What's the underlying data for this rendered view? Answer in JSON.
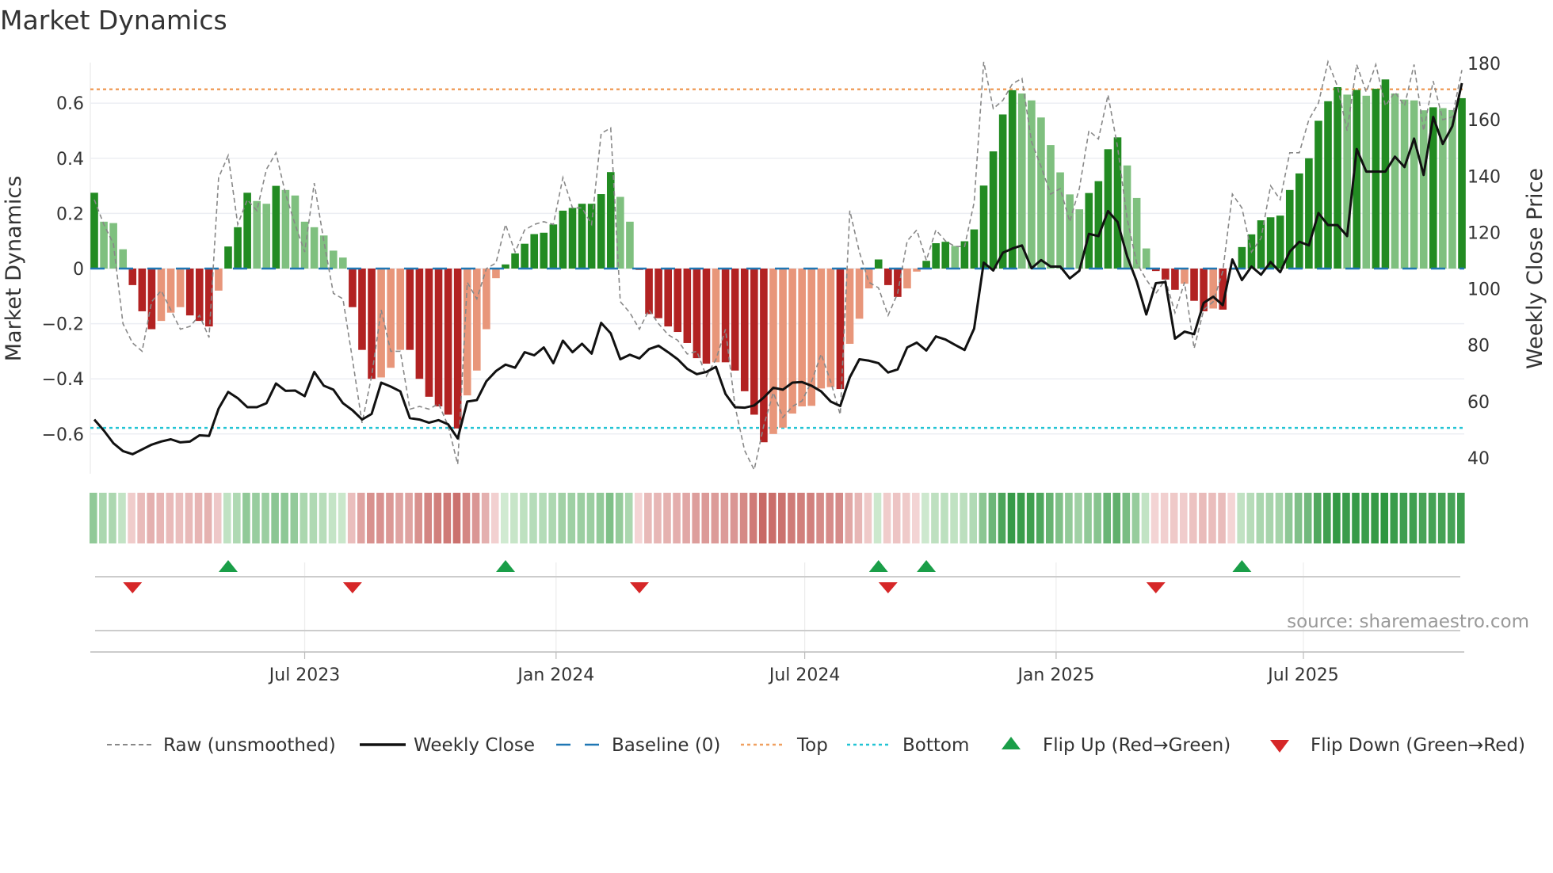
{
  "header": {
    "title": "Market Dynamics"
  },
  "source": "source: sharemaestro.com",
  "colors": {
    "up_strong": "#228b22",
    "up_weak": "#7fc07f",
    "down_strong": "#b22222",
    "down_weak": "#e8967a",
    "close": "#111111",
    "raw": "#888888",
    "baseline": "#1f77b4",
    "top": "#f0a060",
    "bottom": "#22c4d4",
    "flip_up": "#1a9e48",
    "flip_down": "#d62728"
  },
  "chart_data": {
    "type": "bar",
    "title": "Market Dynamics",
    "ylabel": "Market Dynamics",
    "y2label": "Weekly Close Price",
    "ylim": [
      -0.75,
      0.75
    ],
    "y2lim": [
      37,
      182
    ],
    "yticks": [
      -0.6,
      -0.4,
      -0.2,
      0,
      0.2,
      0.4,
      0.6
    ],
    "ytick_labels": [
      "−0.6",
      "−0.4",
      "−0.2",
      "0",
      "0.2",
      "0.4",
      "0.6"
    ],
    "y2ticks": [
      40,
      60,
      80,
      100,
      120,
      140,
      160,
      180
    ],
    "y2tick_labels": [
      "40",
      "60",
      "80",
      "100",
      "120",
      "140",
      "160",
      "180"
    ],
    "x_start": "2023-01-28",
    "x_step_days": 7,
    "xticks": [
      {
        "date": "2023-07-01",
        "label": "Jul 2023"
      },
      {
        "date": "2024-01-01",
        "label": "Jan 2024"
      },
      {
        "date": "2024-07-01",
        "label": "Jul 2024"
      },
      {
        "date": "2025-01-01",
        "label": "Jan 2025"
      },
      {
        "date": "2025-07-01",
        "label": "Jul 2025"
      }
    ],
    "top_level": 0.65,
    "bottom_level": -0.578,
    "baseline": 0,
    "grid": true,
    "legend_position": "bottom",
    "series": [
      {
        "name": "Market Dynamics (smoothed)",
        "type": "bar",
        "axis": "left",
        "values": [
          0.275,
          0.17,
          0.165,
          0.07,
          -0.06,
          -0.155,
          -0.22,
          -0.19,
          -0.16,
          -0.14,
          -0.17,
          -0.19,
          -0.21,
          -0.08,
          0.08,
          0.15,
          0.275,
          0.245,
          0.235,
          0.3,
          0.285,
          0.265,
          0.17,
          0.15,
          0.12,
          0.065,
          0.04,
          -0.14,
          -0.295,
          -0.4,
          -0.395,
          -0.36,
          -0.295,
          -0.295,
          -0.4,
          -0.465,
          -0.5,
          -0.53,
          -0.58,
          -0.46,
          -0.37,
          -0.22,
          -0.035,
          0.015,
          0.055,
          0.09,
          0.125,
          0.13,
          0.16,
          0.21,
          0.22,
          0.235,
          0.235,
          0.27,
          0.35,
          0.26,
          0.17,
          -0.005,
          -0.165,
          -0.18,
          -0.21,
          -0.23,
          -0.27,
          -0.325,
          -0.345,
          -0.34,
          -0.34,
          -0.37,
          -0.445,
          -0.53,
          -0.63,
          -0.6,
          -0.577,
          -0.526,
          -0.5,
          -0.498,
          -0.435,
          -0.43,
          -0.437,
          -0.273,
          -0.182,
          -0.072,
          0.033,
          -0.06,
          -0.103,
          -0.072,
          -0.011,
          0.028,
          0.092,
          0.097,
          0.082,
          0.099,
          0.142,
          0.301,
          0.425,
          0.559,
          0.647,
          0.635,
          0.61,
          0.548,
          0.448,
          0.349,
          0.269,
          0.215,
          0.274,
          0.317,
          0.433,
          0.476,
          0.374,
          0.256,
          0.073,
          -0.009,
          -0.04,
          -0.077,
          -0.055,
          -0.117,
          -0.155,
          -0.145,
          -0.149,
          -0.005,
          0.078,
          0.124,
          0.175,
          0.186,
          0.192,
          0.285,
          0.345,
          0.4,
          0.536,
          0.607,
          0.658,
          0.631,
          0.648,
          0.627,
          0.652,
          0.686,
          0.635,
          0.613,
          0.61,
          0.574,
          0.585,
          0.582,
          0.575,
          0.618
        ]
      },
      {
        "name": "Raw (unsmoothed)",
        "type": "line",
        "axis": "left",
        "values": [
          0.25,
          0.16,
          0.09,
          -0.2,
          -0.27,
          -0.3,
          -0.12,
          -0.08,
          -0.15,
          -0.22,
          -0.21,
          -0.17,
          -0.25,
          0.33,
          0.41,
          0.16,
          0.25,
          0.21,
          0.36,
          0.42,
          0.27,
          0.16,
          0.06,
          0.31,
          0.1,
          -0.09,
          -0.11,
          -0.33,
          -0.56,
          -0.39,
          -0.15,
          -0.3,
          -0.3,
          -0.51,
          -0.5,
          -0.51,
          -0.49,
          -0.57,
          -0.71,
          -0.05,
          -0.11,
          0,
          0.02,
          0.16,
          0.06,
          0.14,
          0.16,
          0.17,
          0.16,
          0.33,
          0.22,
          0.22,
          0.16,
          0.49,
          0.51,
          -0.12,
          -0.16,
          -0.22,
          -0.15,
          -0.2,
          -0.24,
          -0.26,
          -0.31,
          -0.3,
          -0.39,
          -0.33,
          -0.22,
          -0.5,
          -0.66,
          -0.73,
          -0.57,
          -0.45,
          -0.54,
          -0.5,
          -0.48,
          -0.41,
          -0.31,
          -0.41,
          -0.53,
          0.21,
          0.06,
          -0.05,
          -0.07,
          -0.17,
          -0.09,
          0.1,
          0.14,
          0.03,
          0.14,
          0.1,
          0.08,
          0.08,
          0.24,
          0.75,
          0.58,
          0.61,
          0.67,
          0.69,
          0.46,
          0.37,
          0.27,
          0.29,
          0.17,
          0.29,
          0.5,
          0.47,
          0.63,
          0.44,
          0.18,
          0.02,
          -0.04,
          -0.09,
          -0.04,
          -0.16,
          -0.05,
          -0.29,
          -0.15,
          -0.12,
          -0.01,
          0.27,
          0.22,
          0.06,
          0.11,
          0.3,
          0.25,
          0.42,
          0.42,
          0.54,
          0.6,
          0.75,
          0.66,
          0.5,
          0.74,
          0.64,
          0.74,
          0.59,
          0.64,
          0.59,
          0.74,
          0.5,
          0.68,
          0.54,
          0.55,
          0.72
        ]
      },
      {
        "name": "Weekly Close",
        "type": "line",
        "axis": "right",
        "values": [
          53.6,
          49.7,
          45.2,
          42.4,
          41.3,
          43.0,
          44.7,
          45.8,
          46.6,
          45.5,
          45.8,
          48.0,
          47.8,
          57.5,
          63.4,
          61.2,
          58.0,
          58.0,
          59.4,
          66.4,
          63.8,
          63.9,
          61.9,
          70.5,
          65.6,
          64.2,
          59.4,
          56.9,
          53.6,
          55.6,
          66.7,
          65.3,
          63.6,
          54.1,
          53.6,
          52.5,
          53.4,
          51.9,
          46.9,
          60.0,
          60.5,
          67.2,
          70.8,
          73.1,
          72.0,
          77.5,
          76.4,
          79.2,
          73.6,
          81.6,
          77.5,
          80.5,
          77.0,
          87.9,
          84.2,
          75.0,
          76.6,
          75.3,
          78.6,
          79.8,
          77.5,
          75.0,
          71.6,
          69.7,
          70.5,
          72.3,
          62.7,
          58.0,
          57.8,
          58.6,
          61.4,
          64.9,
          64.2,
          66.7,
          66.9,
          65.6,
          63.6,
          60.0,
          58.4,
          68.6,
          75.0,
          74.5,
          73.6,
          70.3,
          71.4,
          79.2,
          80.9,
          78.1,
          83.1,
          82.0,
          80.1,
          78.3,
          85.9,
          109.3,
          106.5,
          112.8,
          114.3,
          115.4,
          107.3,
          110.2,
          107.9,
          107.9,
          103.7,
          106.4,
          119.5,
          118.7,
          127.6,
          123.7,
          111.5,
          102.6,
          90.9,
          102.0,
          102.4,
          82.3,
          84.8,
          83.9,
          95.0,
          97.2,
          94.2,
          110.4,
          103.1,
          107.9,
          105.0,
          109.5,
          105.9,
          113.2,
          116.7,
          115.4,
          126.9,
          122.6,
          122.6,
          118.7,
          149.6,
          141.6,
          141.6,
          141.6,
          146.9,
          143.2,
          153.3,
          140.4,
          161.0,
          151.4,
          157.7,
          173.0
        ]
      }
    ],
    "legend": [
      {
        "key": "raw",
        "label": "Raw (unsmoothed)"
      },
      {
        "key": "close",
        "label": "Weekly Close"
      },
      {
        "key": "baseline",
        "label": "Baseline (0)"
      },
      {
        "key": "top",
        "label": "Top"
      },
      {
        "key": "bottom",
        "label": "Bottom"
      },
      {
        "key": "flip_up",
        "label": "Flip Up (Red→Green)"
      },
      {
        "key": "flip_down",
        "label": "Flip Down (Green→Red)"
      }
    ]
  }
}
